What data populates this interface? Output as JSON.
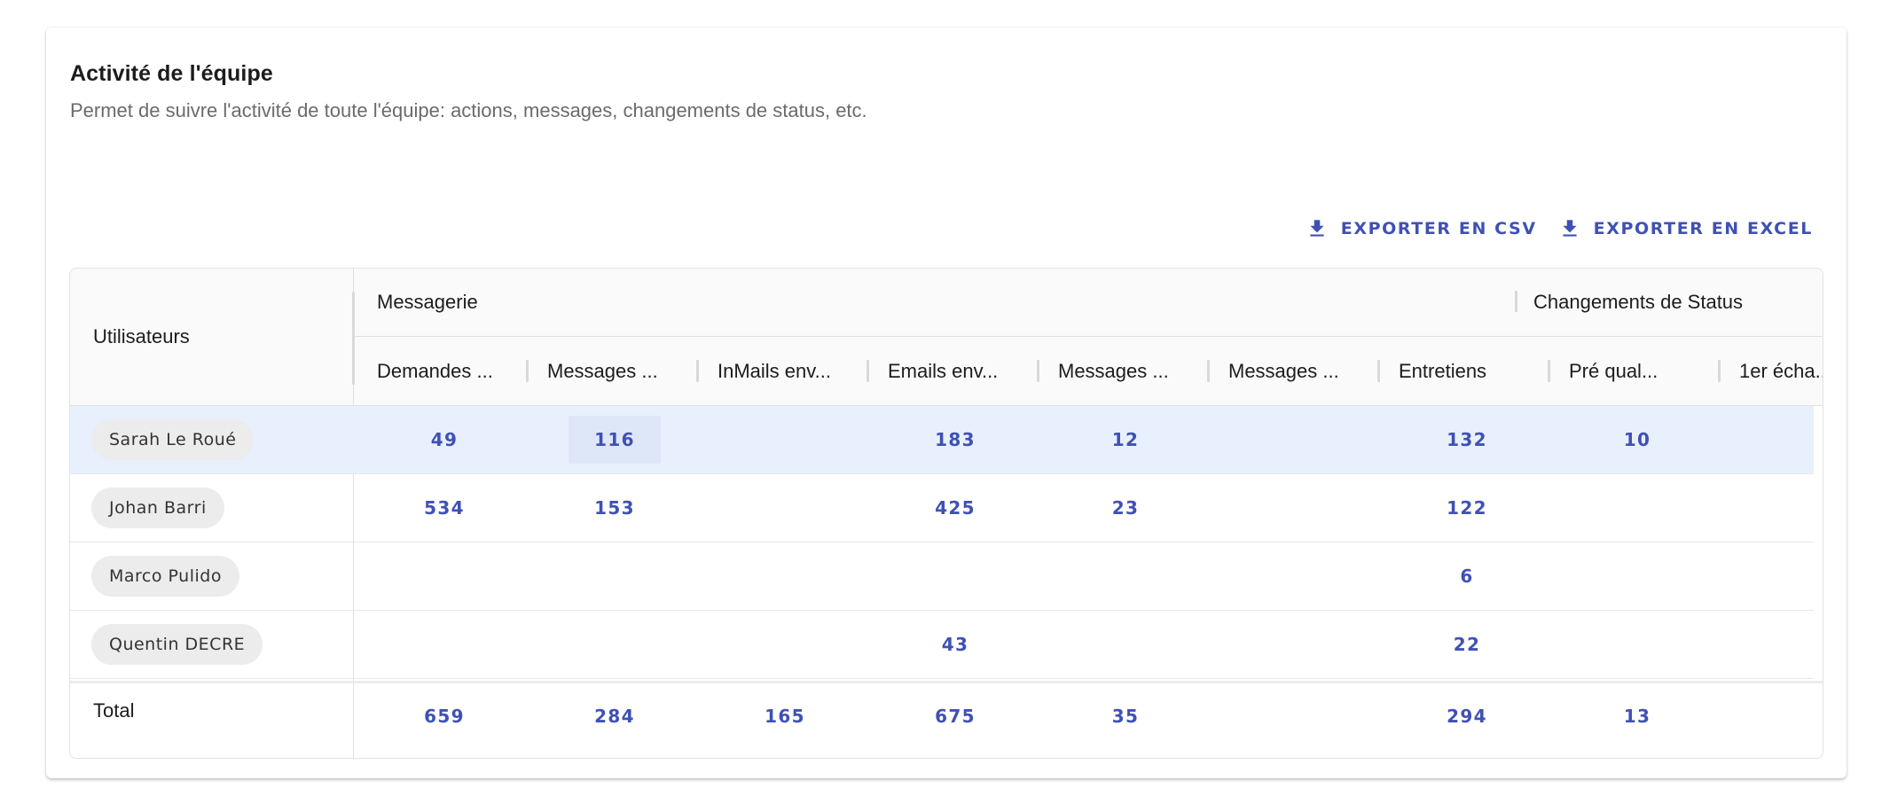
{
  "header": {
    "title": "Activité de l'équipe",
    "subtitle": "Permet de suivre l'activité de toute l'équipe: actions, messages, changements de status, etc."
  },
  "toolbar": {
    "export_csv_label": "EXPORTER EN CSV",
    "export_excel_label": "EXPORTER EN EXCEL"
  },
  "table": {
    "users_header": "Utilisateurs",
    "groups": [
      "Messagerie",
      "Changements de Status"
    ],
    "columns": [
      "Demandes ...",
      "Messages ...",
      "InMails env...",
      "Emails env...",
      "Messages ...",
      "Messages ...",
      "Entretiens",
      "Pré qual...",
      "1er écha..."
    ],
    "rows": [
      {
        "user": "Sarah Le Roué",
        "values": [
          "49",
          "116",
          "",
          "183",
          "12",
          "",
          "132",
          "10",
          ""
        ]
      },
      {
        "user": "Johan Barri",
        "values": [
          "534",
          "153",
          "",
          "425",
          "23",
          "",
          "122",
          "",
          ""
        ]
      },
      {
        "user": "Marco Pulido",
        "values": [
          "",
          "",
          "",
          "",
          "",
          "",
          "6",
          "",
          ""
        ]
      },
      {
        "user": "Quentin DECRE",
        "values": [
          "",
          "",
          "",
          "43",
          "",
          "",
          "22",
          "",
          ""
        ]
      }
    ],
    "total_label": "Total",
    "totals": [
      "659",
      "284",
      "165",
      "675",
      "35",
      "",
      "294",
      "13",
      ""
    ]
  },
  "colors": {
    "accent": "#3f51b5",
    "selected_row": "#e8f0fd",
    "chip_bg": "#ececec"
  },
  "icons": {
    "export": "download-icon"
  }
}
